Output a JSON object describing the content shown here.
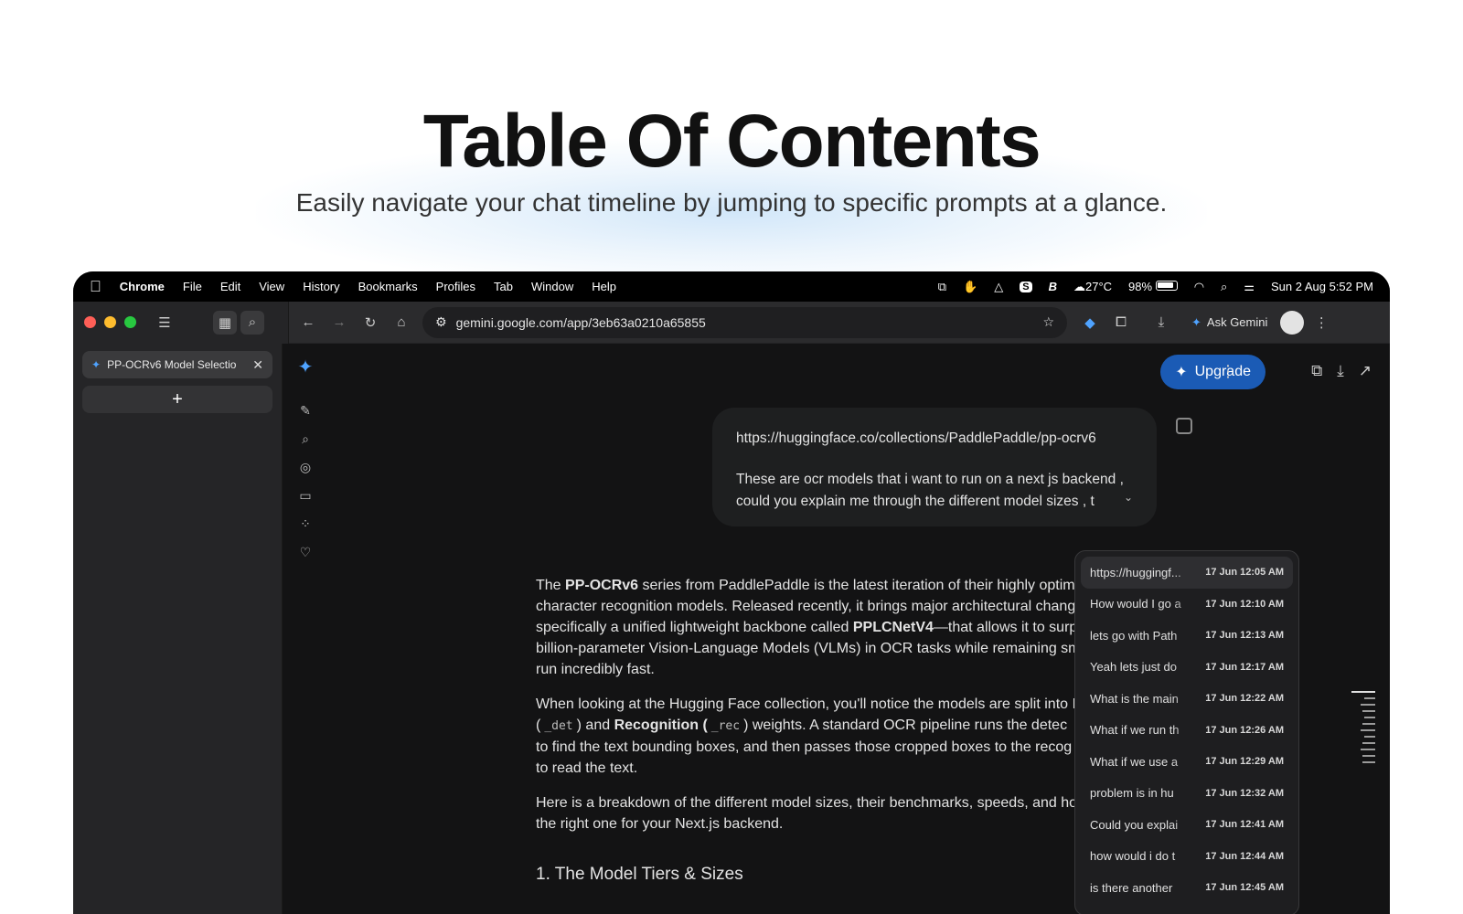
{
  "hero": {
    "title": "Table Of Contents",
    "subtitle": "Easily navigate your chat timeline by jumping to specific prompts at a glance."
  },
  "menubar": {
    "app": "Chrome",
    "items": [
      "File",
      "Edit",
      "View",
      "History",
      "Bookmarks",
      "Profiles",
      "Tab",
      "Window",
      "Help"
    ],
    "weather": "27°C",
    "battery": "98%",
    "datetime": "Sun 2 Aug  5:52 PM"
  },
  "browser": {
    "url": "gemini.google.com/app/3eb63a0210a65855",
    "ask_gemini": "Ask Gemini",
    "tab_title": "PP-OCRv6 Model Selectio",
    "new_tab": "+"
  },
  "gemini": {
    "upgrade": "Upgrade",
    "user_prompt_line1": "https://huggingface.co/collections/PaddlePaddle/pp-ocrv6",
    "user_prompt_line2": "These are ocr models that i want to run on a next js backend ,",
    "user_prompt_line3": "could you explain me through the different model sizes , t",
    "answer": {
      "p1": [
        {
          "pre": "The ",
          "bold": "PP-OCRv6",
          "post": " series from PaddlePaddle is the latest iteration of their highly optimi"
        },
        "character recognition models. Released recently, it brings major architectural chang",
        {
          "pre": "specifically a unified lightweight backbone called ",
          "bold": "PPLCNetV4",
          "post": "—that allows it to surp"
        },
        "billion-parameter Vision-Language Models (VLMs) in OCR tasks while remaining sm",
        "run incredibly fast."
      ],
      "p2_line1": "When looking at the Hugging Face collection, you'll notice the models are split into I",
      "p2_line2_a": "(",
      "p2_code1": "_det",
      "p2_line2_b": ") and ",
      "p2_bold": "Recognition (",
      "p2_code2": "_rec",
      "p2_line2_c": ") weights. A standard OCR pipeline runs the detec",
      "p2_line3": "to find the text bounding boxes, and then passes those cropped boxes to the recog",
      "p2_line4": "to read the text.",
      "p3_line1": "Here is a breakdown of the different model sizes, their benchmarks, speeds, and ho",
      "p3_line2": "the right one for your Next.js backend.",
      "h1": "1. The Model Tiers & Sizes"
    },
    "toc": [
      {
        "q": "https://huggingf...",
        "t": "17 Jun 12:05 AM"
      },
      {
        "q": "How would I go a",
        "t": "17 Jun 12:10 AM"
      },
      {
        "q": "lets go with Path",
        "t": "17 Jun 12:13 AM"
      },
      {
        "q": "Yeah lets just do",
        "t": "17 Jun 12:17 AM"
      },
      {
        "q": "What is the main",
        "t": "17 Jun 12:22 AM"
      },
      {
        "q": "What if we run th",
        "t": "17 Jun 12:26 AM"
      },
      {
        "q": "What if we use a",
        "t": "17 Jun 12:29 AM"
      },
      {
        "q": "problem is in hu",
        "t": "17 Jun 12:32 AM"
      },
      {
        "q": "Could you explai",
        "t": "17 Jun 12:41 AM"
      },
      {
        "q": "how would i do t",
        "t": "17 Jun 12:44 AM"
      },
      {
        "q": "is there another",
        "t": "17 Jun 12:45 AM"
      }
    ]
  },
  "colors": {
    "upgrade_bg": "#1b5bb5",
    "close_dot": "#ff5f57",
    "min_dot": "#febc2e",
    "max_dot": "#28c840"
  }
}
